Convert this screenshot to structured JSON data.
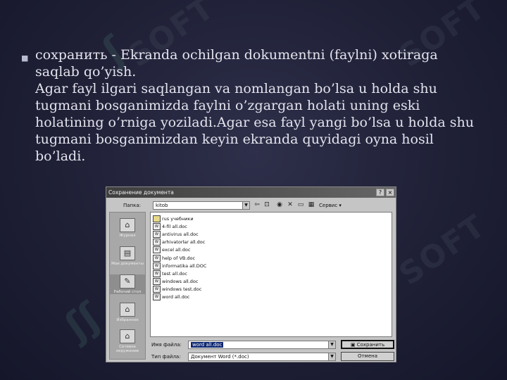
{
  "watermark": {
    "text": "SOFT"
  },
  "slide": {
    "bullet_lead": "сохранить - Ekranda ochilgan dokumentni (faylni) xotiraga saqlab qo’yish.",
    "para_2": "Agar fayl ilgari saqlangan va nomlangan bo’lsa u holda shu tugmani bosganimizda faylni o’zgargan holati uning eski holatining o’rniga yoziladi.Agar esa fayl yangi bo’lsa u holda shu tugmani bosganimizdan keyin ekranda quyidagi oyna hosil bo’ladi."
  },
  "dialog": {
    "title": "Сохранение документа",
    "help_btn": "?",
    "close_btn": "×",
    "folder_label": "Папка:",
    "folder_value": "kitob",
    "service_label": "Сервис",
    "places": [
      {
        "icon": "history-icon",
        "label": "Журнал"
      },
      {
        "icon": "my-documents-icon",
        "label": "Мои документы"
      },
      {
        "icon": "desktop-icon",
        "label": "Рабочий стол"
      },
      {
        "icon": "favorites-icon",
        "label": "Избранное"
      },
      {
        "icon": "network-icon",
        "label": "Сетевое окружение"
      }
    ],
    "files": [
      {
        "name": "rus учебники",
        "type": "folder"
      },
      {
        "name": "4-fil all.doc",
        "type": "doc"
      },
      {
        "name": "antivirus all.doc",
        "type": "doc"
      },
      {
        "name": "arhivatorlar all.doc",
        "type": "doc"
      },
      {
        "name": "excel all.doc",
        "type": "doc"
      },
      {
        "name": "help of VB.doc",
        "type": "doc"
      },
      {
        "name": "informatika all.DOC",
        "type": "doc"
      },
      {
        "name": "test all.doc",
        "type": "doc"
      },
      {
        "name": "windows all.doc",
        "type": "doc"
      },
      {
        "name": "windows test.doc",
        "type": "doc"
      },
      {
        "name": "word all.doc",
        "type": "doc"
      }
    ],
    "filename_label": "Имя файла:",
    "filename_value": "word all.doc",
    "filetype_label": "Тип файла:",
    "filetype_value": "Документ Word (*.doc)",
    "save_btn": "Сохранить",
    "cancel_btn": "Отмена"
  }
}
